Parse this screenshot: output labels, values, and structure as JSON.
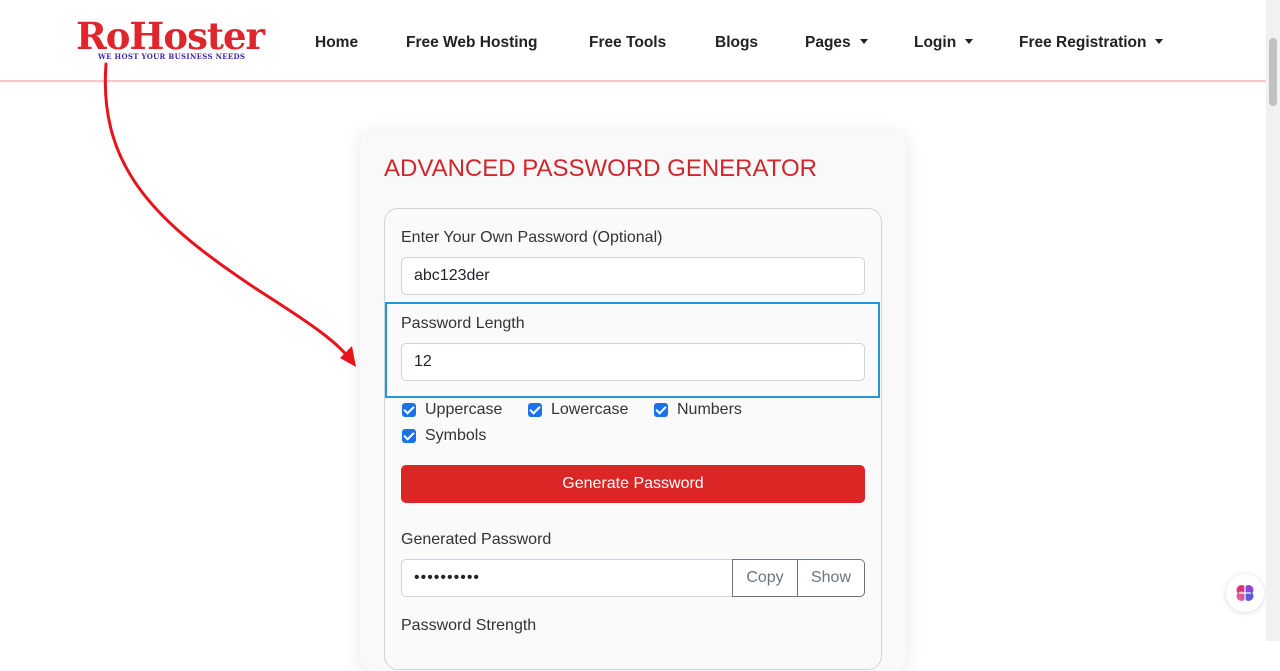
{
  "brand": {
    "logo_text": "RoHoster",
    "tagline": "WE HOST YOUR BUSINESS NEEDS",
    "color": "#e0262c"
  },
  "nav": {
    "items": [
      {
        "label": "Home",
        "dropdown": false
      },
      {
        "label": "Free Web Hosting",
        "dropdown": false
      },
      {
        "label": "Free Tools",
        "dropdown": false
      },
      {
        "label": "Blogs",
        "dropdown": false
      },
      {
        "label": "Pages",
        "dropdown": true
      },
      {
        "label": "Login",
        "dropdown": true
      },
      {
        "label": "Free Registration",
        "dropdown": true
      }
    ]
  },
  "generator": {
    "title": "ADVANCED PASSWORD GENERATOR",
    "own_password_label": "Enter Your Own Password (Optional)",
    "own_password_value": "abc123der",
    "length_label": "Password Length",
    "length_value": "12",
    "options": [
      {
        "label": "Uppercase",
        "checked": true
      },
      {
        "label": "Lowercase",
        "checked": true
      },
      {
        "label": "Numbers",
        "checked": true
      },
      {
        "label": "Symbols",
        "checked": true
      }
    ],
    "generate_button": "Generate Password",
    "generated_label": "Generated Password",
    "generated_value": "••••••••••",
    "copy_button": "Copy",
    "show_button": "Show",
    "strength_label": "Password Strength"
  },
  "colors": {
    "accent": "#dc2626",
    "title": "#d1262b",
    "checkbox": "#1a73e8",
    "focus": "#2196d9"
  },
  "icons": {
    "floating_widget": "brain-icon",
    "annotation": "red-curved-arrow"
  }
}
